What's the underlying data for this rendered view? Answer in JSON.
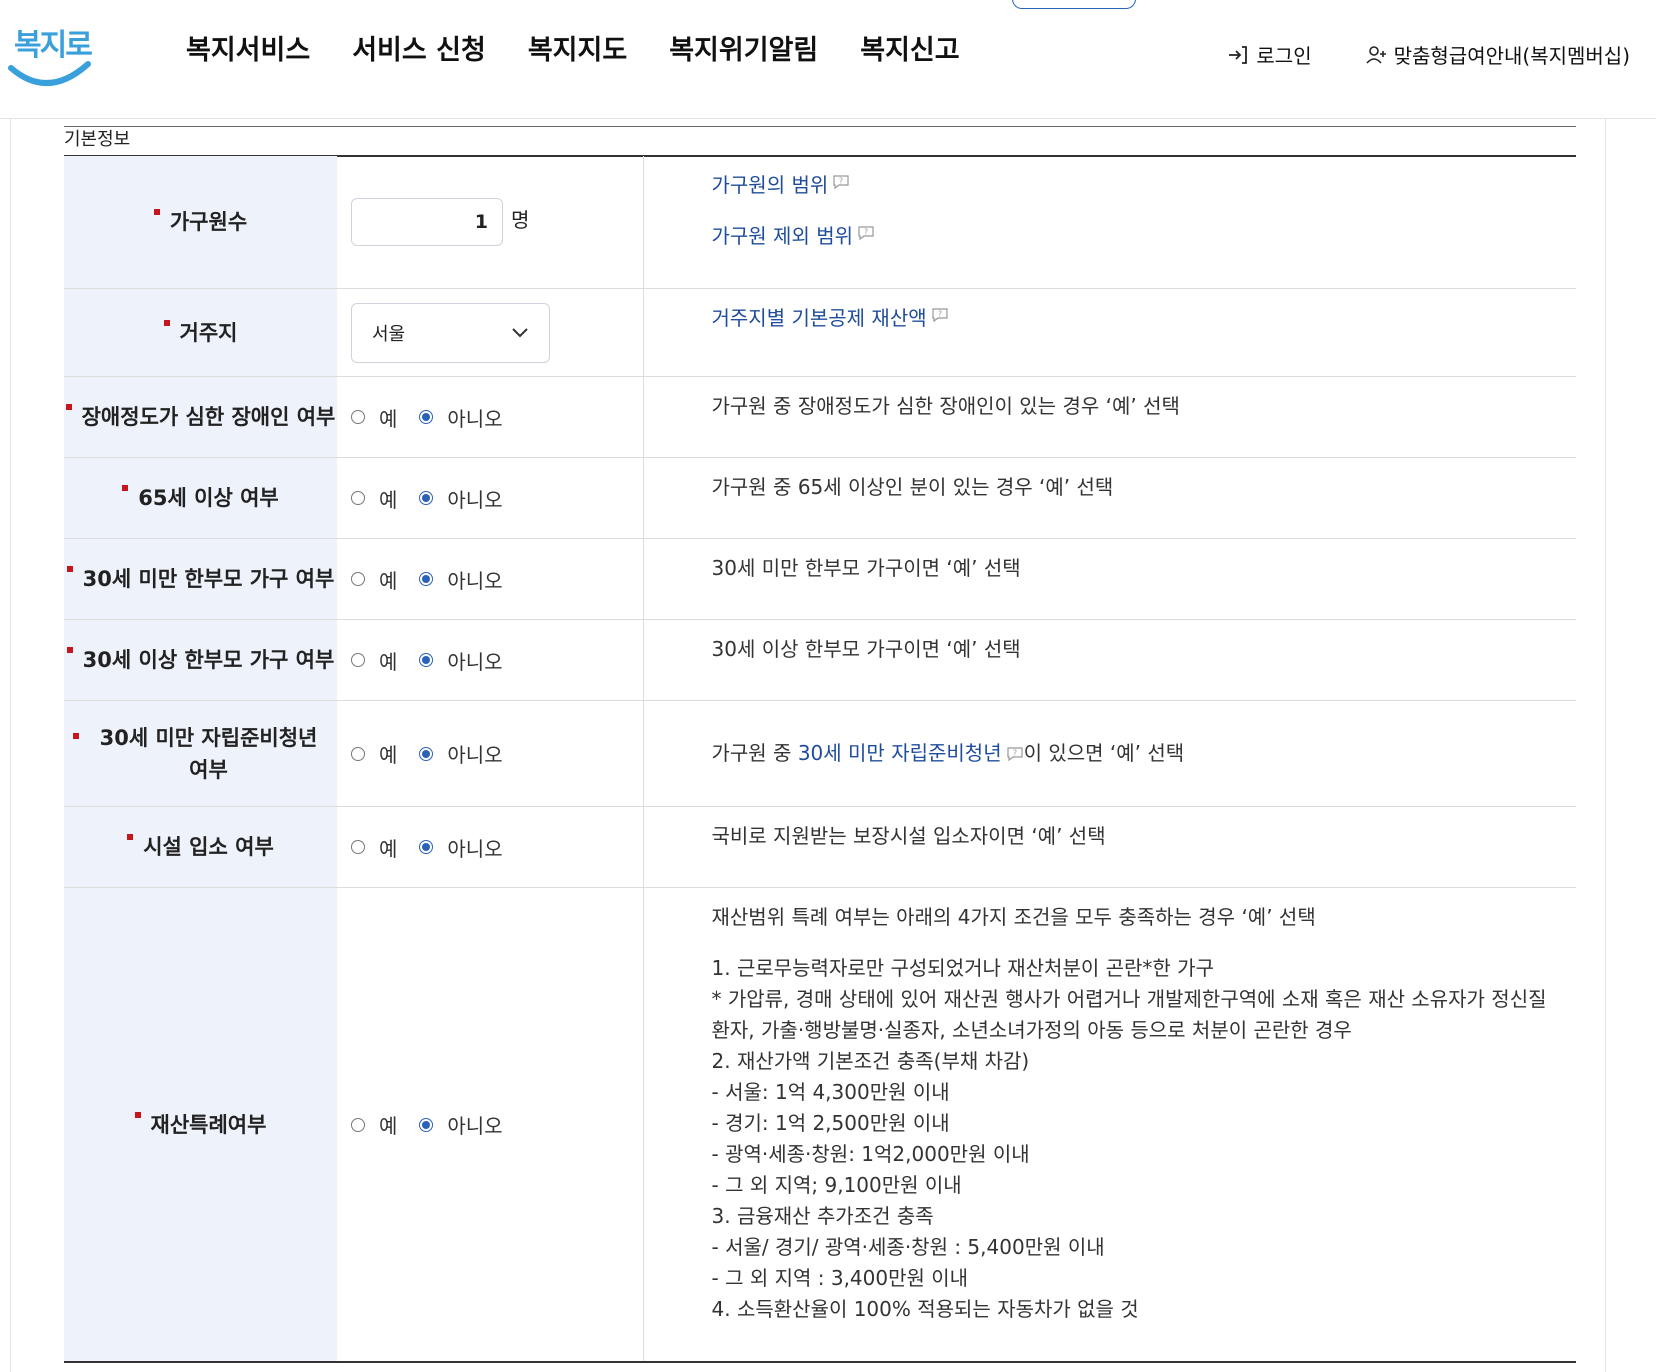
{
  "header": {
    "logo_text": "복지로",
    "nav": [
      "복지서비스",
      "서비스 신청",
      "복지지도",
      "복지위기알림",
      "복지신고"
    ],
    "login": "로그인",
    "membership": "맞춤형급여안내(복지멤버십)"
  },
  "section": {
    "title": "기본정보"
  },
  "rows": {
    "household": {
      "label": "가구원수",
      "value": "1",
      "unit": "명",
      "link1": "가구원의 범위",
      "link2": "가구원 제외 범위"
    },
    "residence": {
      "label": "거주지",
      "selected": "서울",
      "link": "거주지별 기본공제 재산액"
    },
    "disabled": {
      "label": "장애정도가 심한 장애인 여부",
      "desc": "가구원 중 장애정도가 심한 장애인이 있는 경우 ‘예’ 선택"
    },
    "senior": {
      "label": "65세 이상 여부",
      "desc": "가구원 중 65세 이상인 분이 있는 경우 ‘예’ 선택"
    },
    "single_under30": {
      "label": "30세 미만 한부모 가구 여부",
      "desc": "30세 미만 한부모 가구이면 ‘예’ 선택"
    },
    "single_over30": {
      "label": "30세 이상 한부모 가구 여부",
      "desc": "30세 이상 한부모 가구이면 ‘예’ 선택"
    },
    "youth": {
      "label": "30세 미만 자립준비청년 여부",
      "desc_prefix": "가구원 중 ",
      "desc_link": "30세 미만 자립준비청년",
      "desc_suffix": "이 있으면 ‘예’ 선택"
    },
    "facility": {
      "label": "시설 입소 여부",
      "desc": "국비로 지원받는 보장시설 입소자이면 ‘예’ 선택"
    },
    "property": {
      "label": "재산특례여부",
      "desc_intro": "재산범위 특례 여부는 아래의 4가지 조건을 모두 충족하는 경우 ‘예’ 선택",
      "lines": [
        "1. 근로무능력자로만 구성되었거나 재산처분이 곤란*한 가구",
        "* 가압류, 경매 상태에 있어 재산권 행사가 어렵거나 개발제한구역에 소재 혹은 재산 소유자가 정신질환자, 가출·행방불명·실종자, 소년소녀가정의 아동 등으로 처분이 곤란한 경우",
        "2. 재산가액 기본조건 충족(부채 차감)",
        "- 서울: 1억 4,300만원 이내",
        "- 경기: 1억 2,500만원 이내",
        "- 광역·세종·창원: 1억2,000만원 이내",
        "- 그 외 지역; 9,100만원 이내",
        "3. 금융재산 추가조건 충족",
        "- 서울/ 경기/ 광역·세종·창원 : 5,400만원 이내",
        "- 그 외 지역 : 3,400만원 이내",
        "4. 소득환산율이 100% 적용되는 자동차가 없을 것"
      ]
    }
  },
  "radio": {
    "yes": "예",
    "no": "아니오"
  },
  "colors": {
    "accent": "#2a62b8",
    "required": "#c4161c",
    "header_bg": "#eef2fa",
    "link": "#1f4d9c"
  }
}
